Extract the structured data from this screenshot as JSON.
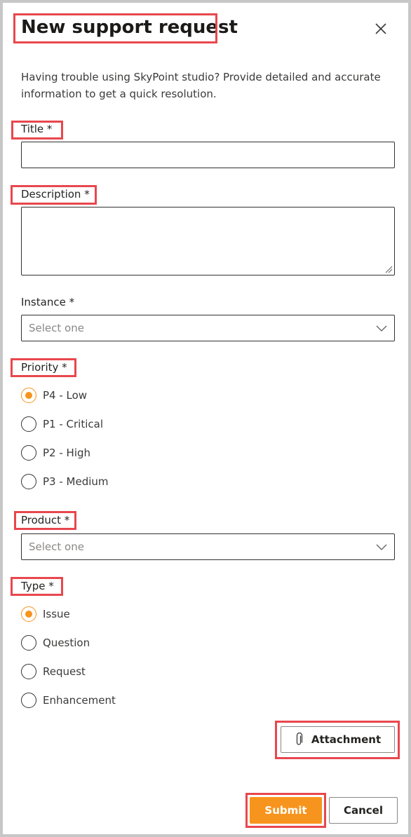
{
  "dialog": {
    "title": "New support request",
    "close_icon": "close-icon",
    "intro": "Having trouble using SkyPoint studio? Provide detailed and accurate information to get a quick resolution."
  },
  "form": {
    "title_label": "Title *",
    "title_value": "",
    "description_label": "Description *",
    "description_value": "",
    "instance_label": "Instance *",
    "instance_placeholder": "Select one",
    "priority_label": "Priority *",
    "priority_options": [
      "P4 - Low",
      "P1 - Critical",
      "P2 - High",
      "P3 - Medium"
    ],
    "priority_selected": "P4 - Low",
    "product_label": "Product *",
    "product_placeholder": "Select one",
    "type_label": "Type *",
    "type_options": [
      "Issue",
      "Question",
      "Request",
      "Enhancement"
    ],
    "type_selected": "Issue"
  },
  "actions": {
    "attachment_label": "Attachment",
    "attachment_icon": "paperclip-icon",
    "submit_label": "Submit",
    "cancel_label": "Cancel"
  },
  "colors": {
    "accent": "#f7941d",
    "highlight": "#e8474d",
    "border": "#323130"
  }
}
